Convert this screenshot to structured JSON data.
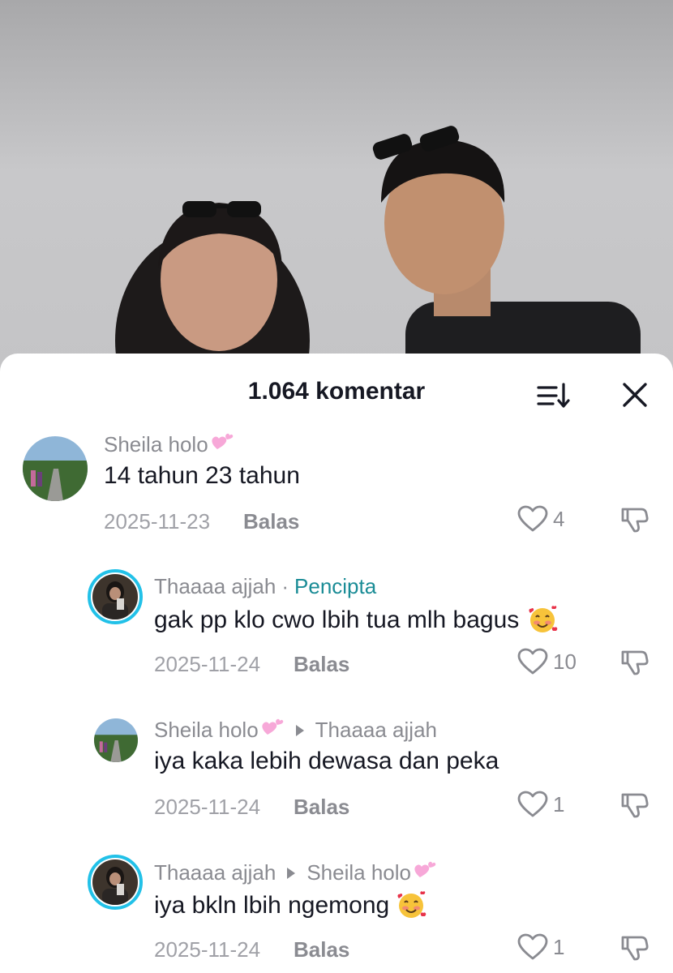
{
  "header": {
    "title": "1.064 komentar"
  },
  "icons": {
    "sort": "sort-icon",
    "close": "close-icon",
    "like": "heart-outline-icon",
    "dislike": "thumbs-down-icon"
  },
  "colors": {
    "creator_label": "#1a8c96",
    "avatar_ring": "#22c1e8",
    "name_gray": "#8a8b91",
    "text": "#161823"
  },
  "comments": [
    {
      "author": "Sheila holo",
      "text": "14 tahun 23 tahun",
      "date": "2025-11-23",
      "reply_label": "Balas",
      "likes": "4"
    },
    {
      "author": "Thaaaa ajjah",
      "separator": "·",
      "creator_label": "Pencipta",
      "text": "gak pp klo cwo lbih tua mlh bagus",
      "date": "2025-11-24",
      "reply_label": "Balas",
      "likes": "10"
    },
    {
      "author": "Sheila holo",
      "reply_to": "Thaaaa ajjah",
      "text": "iya kaka lebih dewasa dan peka",
      "date": "2025-11-24",
      "reply_label": "Balas",
      "likes": "1"
    },
    {
      "author": "Thaaaa ajjah",
      "reply_to": "Sheila holo",
      "text": "iya bkln lbih ngemong",
      "date": "2025-11-24",
      "reply_label": "Balas",
      "likes": "1"
    }
  ]
}
